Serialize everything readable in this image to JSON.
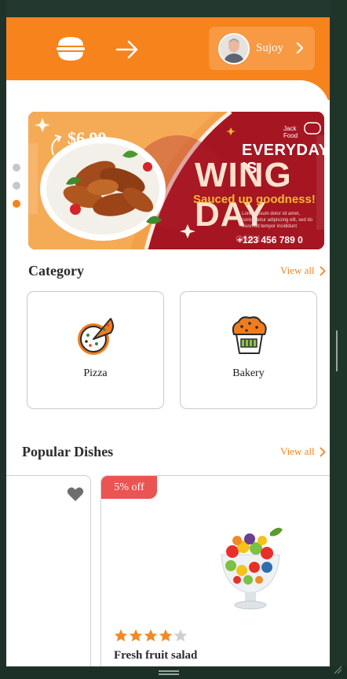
{
  "header": {
    "profile_name": "Sujoy"
  },
  "banner": {
    "price": "$6.99",
    "brand": "Jack Food",
    "headline_top": "EVERYDAY IS",
    "headline_main": "WING DAY",
    "tagline": "Sauced up goodness!",
    "body": "Lorem ipsum dolor sit amet, consectetur adipiscing elit, sed do eiusmod tempor incididunt",
    "watermark": "ONLI",
    "phone": "+123 456 789 0",
    "slide_count": 3,
    "active_slide": 3
  },
  "category": {
    "title": "Category",
    "view_all": "View all",
    "items": [
      {
        "label": "Pizza",
        "icon": "pizza-icon"
      },
      {
        "label": "Bakery",
        "icon": "cupcake-icon"
      }
    ]
  },
  "popular": {
    "title": "Popular Dishes",
    "view_all": "View all",
    "dishes": [
      {
        "name": "Fresh fruit salad",
        "discount": "5% off",
        "rating": 4,
        "rating_max": 5
      }
    ]
  },
  "colors": {
    "brand_orange": "#f7831c",
    "badge_red": "#ea5452",
    "banner_red": "#a41622",
    "star_orange": "#f08a24"
  }
}
